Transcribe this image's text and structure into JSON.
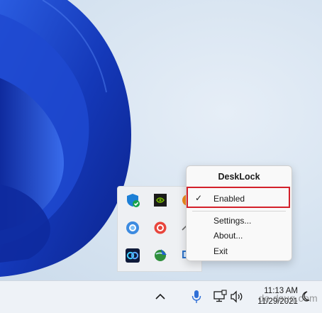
{
  "menu": {
    "title": "DeskLock",
    "items": [
      {
        "label": "Enabled",
        "checked": true
      },
      {
        "label": "Settings..."
      },
      {
        "label": "About..."
      },
      {
        "label": "Exit"
      }
    ]
  },
  "tray_icons": [
    {
      "name": "windows-security-icon"
    },
    {
      "name": "nvidia-icon"
    },
    {
      "name": "orange-app-icon"
    },
    {
      "name": "blue-circle-app-icon"
    },
    {
      "name": "red-circle-app-icon"
    },
    {
      "name": "chevron-up-partial-icon"
    },
    {
      "name": "webex-icon"
    },
    {
      "name": "network-globe-app-icon"
    },
    {
      "name": "display-app-icon"
    }
  ],
  "taskbar": {
    "time": "11:13 AM",
    "date": "11/29/2021"
  },
  "watermark": "de.dsuq.com",
  "colors": {
    "highlight_border": "#d3202a",
    "wallpaper_blue": "#1438b8"
  }
}
